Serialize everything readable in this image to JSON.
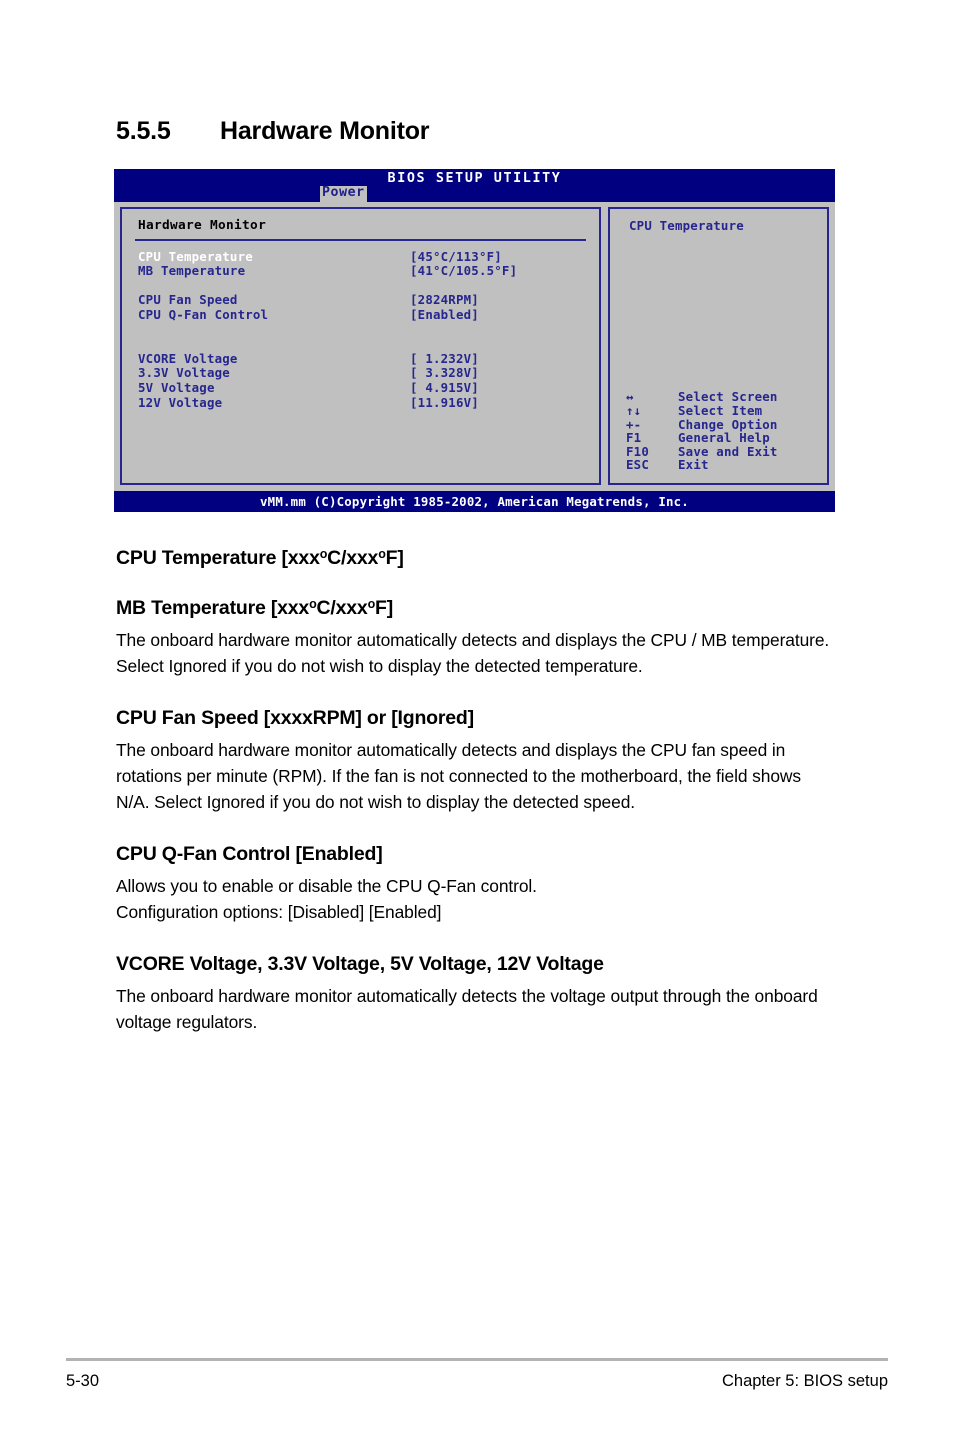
{
  "section": {
    "number": "5.5.5",
    "title": "Hardware Monitor"
  },
  "bios": {
    "title": "BIOS SETUP UTILITY",
    "active_tab": "Power",
    "panel_title": "Hardware Monitor",
    "items": [
      {
        "label": "CPU Temperature",
        "value": "[45°C/113°F]",
        "selected": true
      },
      {
        "label": "MB Temperature",
        "value": "[41°C/105.5°F]",
        "selected": false
      },
      {
        "label": "",
        "value": "",
        "selected": false
      },
      {
        "label": "CPU Fan Speed",
        "value": "[2824RPM]",
        "selected": false
      },
      {
        "label": "CPU Q-Fan Control",
        "value": "[Enabled]",
        "selected": false
      },
      {
        "label": "",
        "value": "",
        "selected": false
      },
      {
        "label": "",
        "value": "",
        "selected": false
      },
      {
        "label": "VCORE Voltage",
        "value": "[ 1.232V]",
        "selected": false
      },
      {
        "label": "3.3V Voltage",
        "value": "[ 3.328V]",
        "selected": false
      },
      {
        "label": "5V Voltage",
        "value": "[ 4.915V]",
        "selected": false
      },
      {
        "label": "12V Voltage",
        "value": "[11.916V]",
        "selected": false
      }
    ],
    "help_title": "CPU Temperature",
    "legend": [
      {
        "key": "↔",
        "action": "Select Screen"
      },
      {
        "key": "↑↓",
        "action": "Select Item"
      },
      {
        "key": "+-",
        "action": "Change Option"
      },
      {
        "key": "F1",
        "action": "General Help"
      },
      {
        "key": "F10",
        "action": "Save and Exit"
      },
      {
        "key": "ESC",
        "action": "Exit"
      }
    ],
    "copyright": "vMM.mm (C)Copyright 1985-2002, American Megatrends, Inc.",
    "colors": {
      "chrome_blue": "#000080",
      "text_blue": "#26268e",
      "panel_gray": "#c0c0c0",
      "selected_text": "#ffffff"
    }
  },
  "body": {
    "entries": [
      {
        "heading_parts": [
          "CPU Temperature [xxx",
          "o",
          "C/xxx",
          "o",
          "F]"
        ],
        "heading_plain": "CPU Temperature [xxxoC/xxxoF]",
        "paragraph": ""
      },
      {
        "heading_parts": [
          "MB Temperature [xxx",
          "o",
          "C/xxx",
          "o",
          "F]"
        ],
        "heading_plain": "MB Temperature [xxxoC/xxxoF]",
        "paragraph": "The onboard hardware monitor automatically detects and displays the CPU / MB temperature. Select Ignored if you do not wish to display the detected temperature."
      },
      {
        "heading_plain": "CPU Fan Speed [xxxxRPM] or [Ignored]",
        "paragraph": "The onboard hardware monitor automatically detects and displays the CPU fan speed in rotations per minute (RPM). If the fan is not connected to the motherboard, the field shows N/A. Select Ignored if you do not wish to display the detected speed."
      },
      {
        "heading_plain": "CPU Q-Fan Control [Enabled]",
        "paragraph": "Allows you to enable or disable the CPU Q-Fan control.\nConfiguration options: [Disabled] [Enabled]"
      },
      {
        "heading_plain": "VCORE Voltage, 3.3V Voltage, 5V Voltage, 12V Voltage",
        "paragraph": "The onboard hardware monitor automatically detects the voltage output through the onboard voltage regulators."
      }
    ]
  },
  "page_footer": {
    "page_number": "5-30",
    "chapter": "Chapter 5: BIOS setup"
  }
}
